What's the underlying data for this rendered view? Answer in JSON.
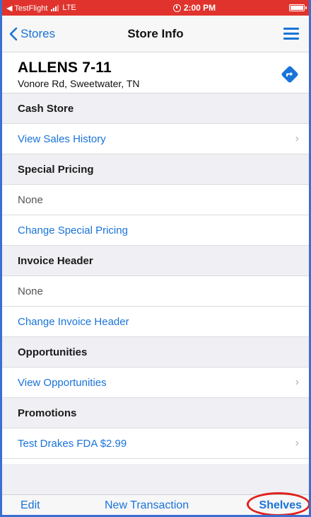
{
  "status_bar": {
    "carrier": "◀ TestFlight",
    "network": "LTE",
    "time": "2:00 PM"
  },
  "nav": {
    "back_label": "Stores",
    "title": "Store Info"
  },
  "store": {
    "name": "ALLENS 7-11",
    "address": "Vonore Rd, Sweetwater, TN"
  },
  "rows": [
    {
      "type": "header",
      "label": "Cash Store"
    },
    {
      "type": "link",
      "label": "View Sales History",
      "chevron": true
    },
    {
      "type": "header",
      "label": "Special Pricing"
    },
    {
      "type": "value",
      "label": "None"
    },
    {
      "type": "link",
      "label": "Change Special Pricing",
      "chevron": false
    },
    {
      "type": "header",
      "label": "Invoice Header"
    },
    {
      "type": "value",
      "label": "None"
    },
    {
      "type": "link",
      "label": "Change Invoice Header",
      "chevron": false
    },
    {
      "type": "header",
      "label": "Opportunities"
    },
    {
      "type": "link",
      "label": "View Opportunities",
      "chevron": true
    },
    {
      "type": "header",
      "label": "Promotions"
    },
    {
      "type": "link",
      "label": "Test Drakes FDA $2.99",
      "chevron": true
    }
  ],
  "toolbar": {
    "edit_label": "Edit",
    "new_transaction_label": "New Transaction",
    "shelves_label": "Shelves"
  },
  "colors": {
    "accent": "#1a73d9",
    "status_bar": "#e0332d",
    "highlight": "#e0221d"
  },
  "icons": {
    "back": "chevron-left-icon",
    "menu": "hamburger-menu-icon",
    "directions": "directions-icon",
    "row_chevron": "chevron-right-icon"
  }
}
